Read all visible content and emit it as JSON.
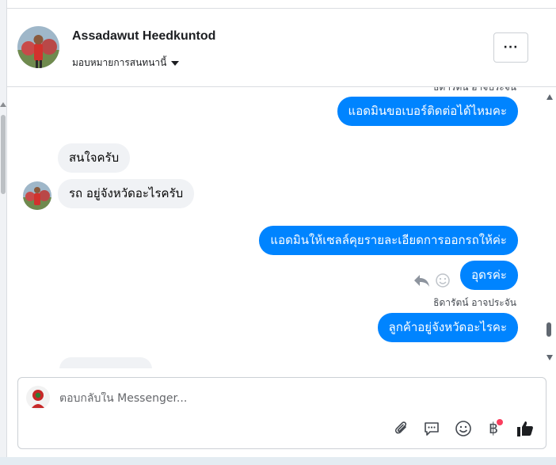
{
  "header": {
    "contact_name": "Assadawut Heedkuntod",
    "assign_label": "มอบหมายการสนทนานี้",
    "more_label": "···"
  },
  "thread": {
    "sender_partial": "ธิดารัตน์ อาจประจัน",
    "messages": [
      {
        "dir": "out",
        "text": "แอดมินขอเบอร์ติดต่อได้ไหมคะ"
      },
      {
        "dir": "in",
        "text": "สนใจครับ"
      },
      {
        "dir": "in",
        "text": "รถ อยู่จังหวัดอะไรครับ"
      },
      {
        "dir": "out",
        "text": "แอดมินให้เซลล์คุยรายละเอียดการออกรถให้ค่ะ"
      },
      {
        "dir": "out",
        "text": "อุดรค่ะ"
      },
      {
        "dir": "out",
        "text": "ลูกค้าอยู่จังหวัดอะไรคะ"
      }
    ],
    "sender_name": "ธิดารัตน์ อาจประจัน"
  },
  "composer": {
    "placeholder": "ตอบกลับใน Messenger...",
    "value": "",
    "baht_symbol": "฿"
  },
  "icons": {
    "attach": "paperclip-icon",
    "saved_reply": "chat-bubble-icon",
    "emoji": "smiley-icon",
    "payment": "baht-icon",
    "like": "thumbs-up-icon",
    "reply": "reply-arrow-icon",
    "react": "smiley-react-icon"
  },
  "colors": {
    "outgoing_bubble": "#0084ff",
    "incoming_bubble": "#f0f2f5",
    "notification_dot": "#fa3e5e"
  }
}
